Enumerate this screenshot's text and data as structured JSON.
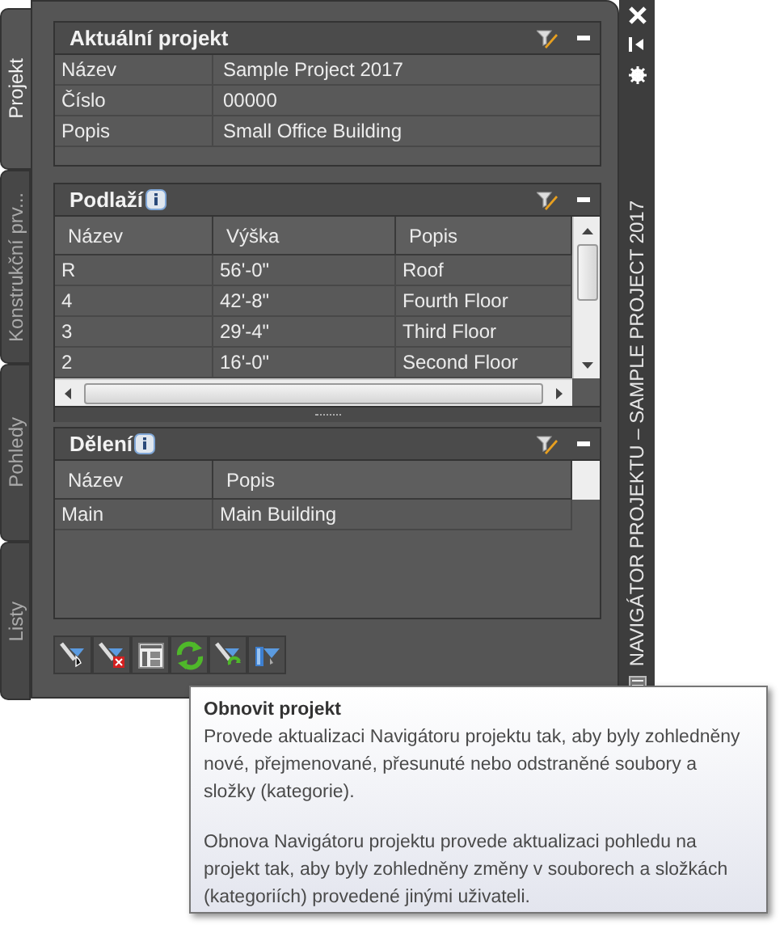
{
  "tabs": [
    {
      "label": "Projekt",
      "selected": true
    },
    {
      "label": "Konstrukční prv...",
      "selected": false
    },
    {
      "label": "Pohledy",
      "selected": false
    },
    {
      "label": "Listy",
      "selected": false
    }
  ],
  "palette_title": "NAVIGÁTOR PROJEKTU – SAMPLE PROJECT 2017",
  "sections": [
    {
      "title": "Aktuální projekt",
      "kind": "properties",
      "info_icon": false,
      "rows": [
        [
          "Název",
          "Sample Project 2017"
        ],
        [
          "Číslo",
          "00000"
        ],
        [
          "Popis",
          "Small Office Building"
        ]
      ]
    },
    {
      "title": "Podlaží",
      "kind": "table",
      "info_icon": true,
      "scrollbars": true,
      "columns": [
        "Název",
        "Výška",
        "Popis"
      ],
      "rows": [
        [
          "R",
          "56'-0\"",
          "Roof"
        ],
        [
          "4",
          "42'-8\"",
          "Fourth Floor"
        ],
        [
          "3",
          "29'-4\"",
          "Third Floor"
        ],
        [
          "2",
          "16'-0\"",
          "Second Floor"
        ]
      ]
    },
    {
      "title": "Dělení",
      "kind": "table",
      "info_icon": true,
      "scrollbars": false,
      "columns": [
        "Název",
        "Popis"
      ],
      "rows": [
        [
          "Main",
          "Main Building"
        ]
      ]
    }
  ],
  "tooltip": {
    "title": "Obnovit projekt",
    "paragraphs": [
      "Provede aktualizaci Navigátoru projektu tak, aby byly zohledněny nové, přejmenované, přesunuté nebo odstraněné soubory a složky (kategorie).",
      "Obnova Navigátoru projektu provede aktualizaci pohledu na projekt tak, aby byly zohledněny změny v souborech a složkách (kategoriích) provedené jinými uživateli."
    ]
  }
}
